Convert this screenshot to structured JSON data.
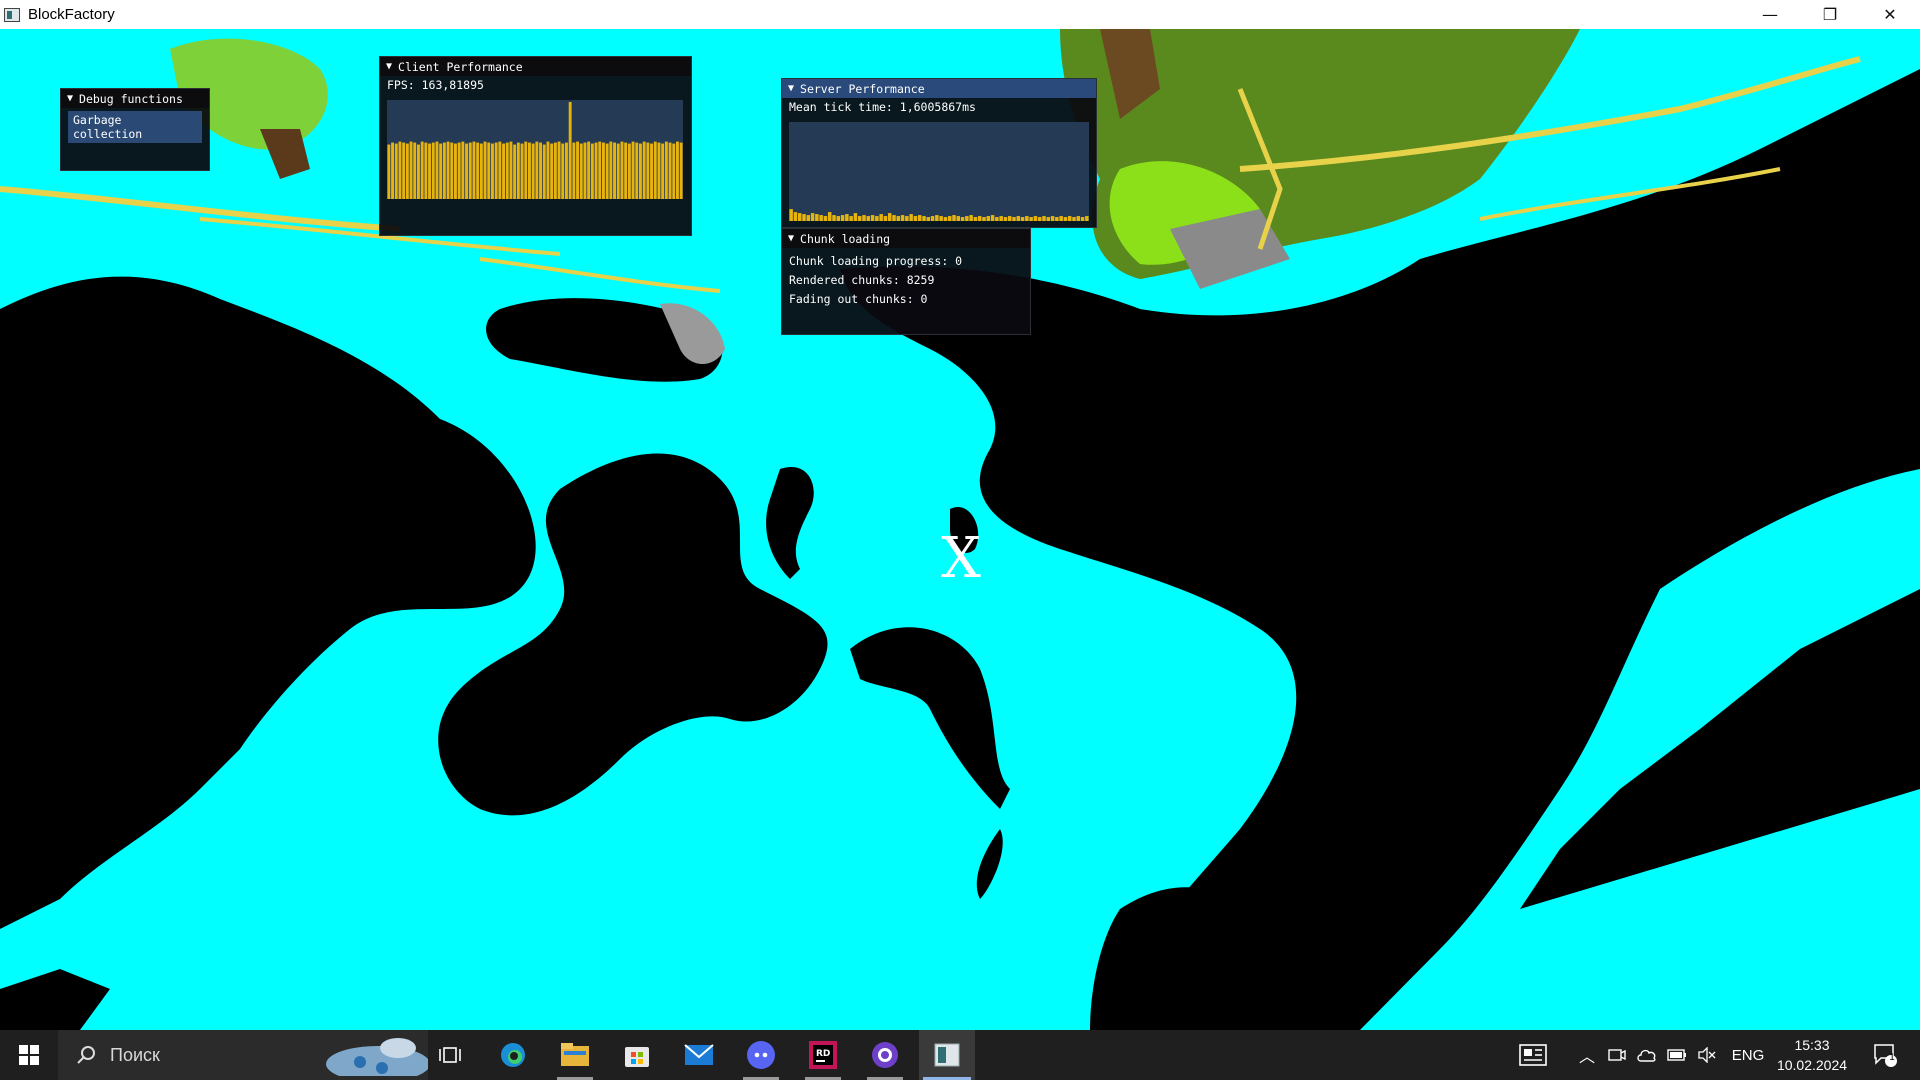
{
  "window": {
    "title": "BlockFactory",
    "controls": {
      "minimize": "—",
      "maximize": "❐",
      "close": "✕"
    }
  },
  "crosshair": "X",
  "debug_functions": {
    "title": "Debug functions",
    "gc_button": "Garbage collection"
  },
  "client_performance": {
    "title": "Client Performance",
    "fps_text": "FPS: 163,81895",
    "bar_color": "#e6b40c",
    "bars": [
      0.55,
      0.57,
      0.56,
      0.58,
      0.57,
      0.56,
      0.58,
      0.57,
      0.55,
      0.58,
      0.57,
      0.56,
      0.57,
      0.58,
      0.56,
      0.57,
      0.58,
      0.57,
      0.56,
      0.57,
      0.58,
      0.56,
      0.57,
      0.58,
      0.57,
      0.56,
      0.58,
      0.57,
      0.56,
      0.57,
      0.58,
      0.56,
      0.57,
      0.58,
      0.55,
      0.57,
      0.56,
      0.58,
      0.57,
      0.56,
      0.58,
      0.57,
      0.55,
      0.58,
      0.56,
      0.57,
      0.58,
      0.56,
      0.57,
      0.98,
      0.57,
      0.58,
      0.56,
      0.57,
      0.58,
      0.56,
      0.57,
      0.58,
      0.57,
      0.56,
      0.58,
      0.57,
      0.56,
      0.58,
      0.57,
      0.56,
      0.58,
      0.57,
      0.56,
      0.58,
      0.57,
      0.56,
      0.58,
      0.57,
      0.56,
      0.58,
      0.57,
      0.56,
      0.58,
      0.57
    ]
  },
  "server_performance": {
    "title": "Server Performance",
    "tick_text": "Mean tick time: 1,6005867ms",
    "bar_color": "#e6b40c",
    "bars": [
      0.12,
      0.09,
      0.08,
      0.07,
      0.06,
      0.08,
      0.07,
      0.06,
      0.05,
      0.09,
      0.06,
      0.05,
      0.06,
      0.07,
      0.05,
      0.08,
      0.05,
      0.06,
      0.05,
      0.06,
      0.05,
      0.07,
      0.05,
      0.08,
      0.06,
      0.05,
      0.06,
      0.05,
      0.07,
      0.05,
      0.06,
      0.05,
      0.04,
      0.05,
      0.06,
      0.05,
      0.04,
      0.05,
      0.06,
      0.05,
      0.04,
      0.05,
      0.06,
      0.04,
      0.05,
      0.04,
      0.05,
      0.06,
      0.04,
      0.05,
      0.04,
      0.05,
      0.04,
      0.05,
      0.04,
      0.05,
      0.04,
      0.05,
      0.04,
      0.05,
      0.04,
      0.05,
      0.04,
      0.05,
      0.04,
      0.05,
      0.04,
      0.05,
      0.04,
      0.05
    ]
  },
  "chunk_loading": {
    "title": "Chunk loading",
    "progress_text": "Chunk loading progress: 0",
    "rendered_text": "Rendered chunks: 8259",
    "fading_text": "Fading out chunks: 0"
  },
  "taskbar": {
    "search_placeholder": "Поиск",
    "pinned": [
      "task-view-icon",
      "edge-icon",
      "file-explorer-icon",
      "store-icon",
      "mail-icon",
      "discord-icon",
      "rider-icon",
      "github-desktop-icon",
      "blockfactory-icon"
    ],
    "language": "ENG",
    "time": "15:33",
    "date": "10.02.2024",
    "notifications_count": "1"
  }
}
